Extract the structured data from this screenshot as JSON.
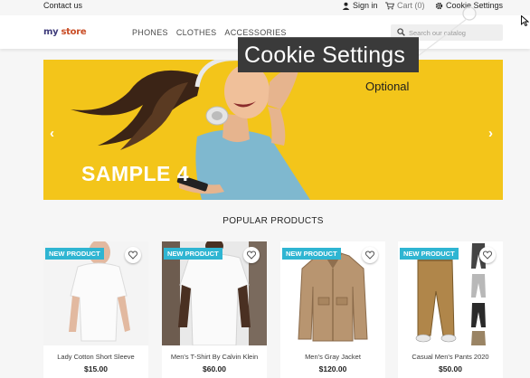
{
  "topbar": {
    "contact": "Contact us",
    "signin": "Sign in",
    "cart": "Cart (0)",
    "cookie": "Cookie Settings"
  },
  "header": {
    "logo_my": "my",
    "logo_store": "store",
    "menu": [
      "PHONES",
      "CLOTHES",
      "ACCESSORIES"
    ],
    "search_placeholder": "Search our catalog"
  },
  "tooltip": {
    "label": "Cookie Settings"
  },
  "hero": {
    "optional": "Optional",
    "title": "SAMPLE 4",
    "prev": "‹",
    "next": "›"
  },
  "section": {
    "title": "POPULAR PRODUCTS"
  },
  "products": [
    {
      "badge": "NEW PRODUCT",
      "name": "Lady Cotton Short Sleeve",
      "price": "$15.00"
    },
    {
      "badge": "NEW PRODUCT",
      "name": "Men's T-Shirt By Calvin Klein",
      "price": "$60.00"
    },
    {
      "badge": "NEW PRODUCT",
      "name": "Men's Gray Jacket",
      "price": "$120.00"
    },
    {
      "badge": "NEW PRODUCT",
      "name": "Casual Men's Pants 2020",
      "price": "$50.00"
    }
  ],
  "colors": {
    "accent": "#2fb5d2",
    "hero_bg": "#f3c51a",
    "logo": "#3d3a7a"
  }
}
